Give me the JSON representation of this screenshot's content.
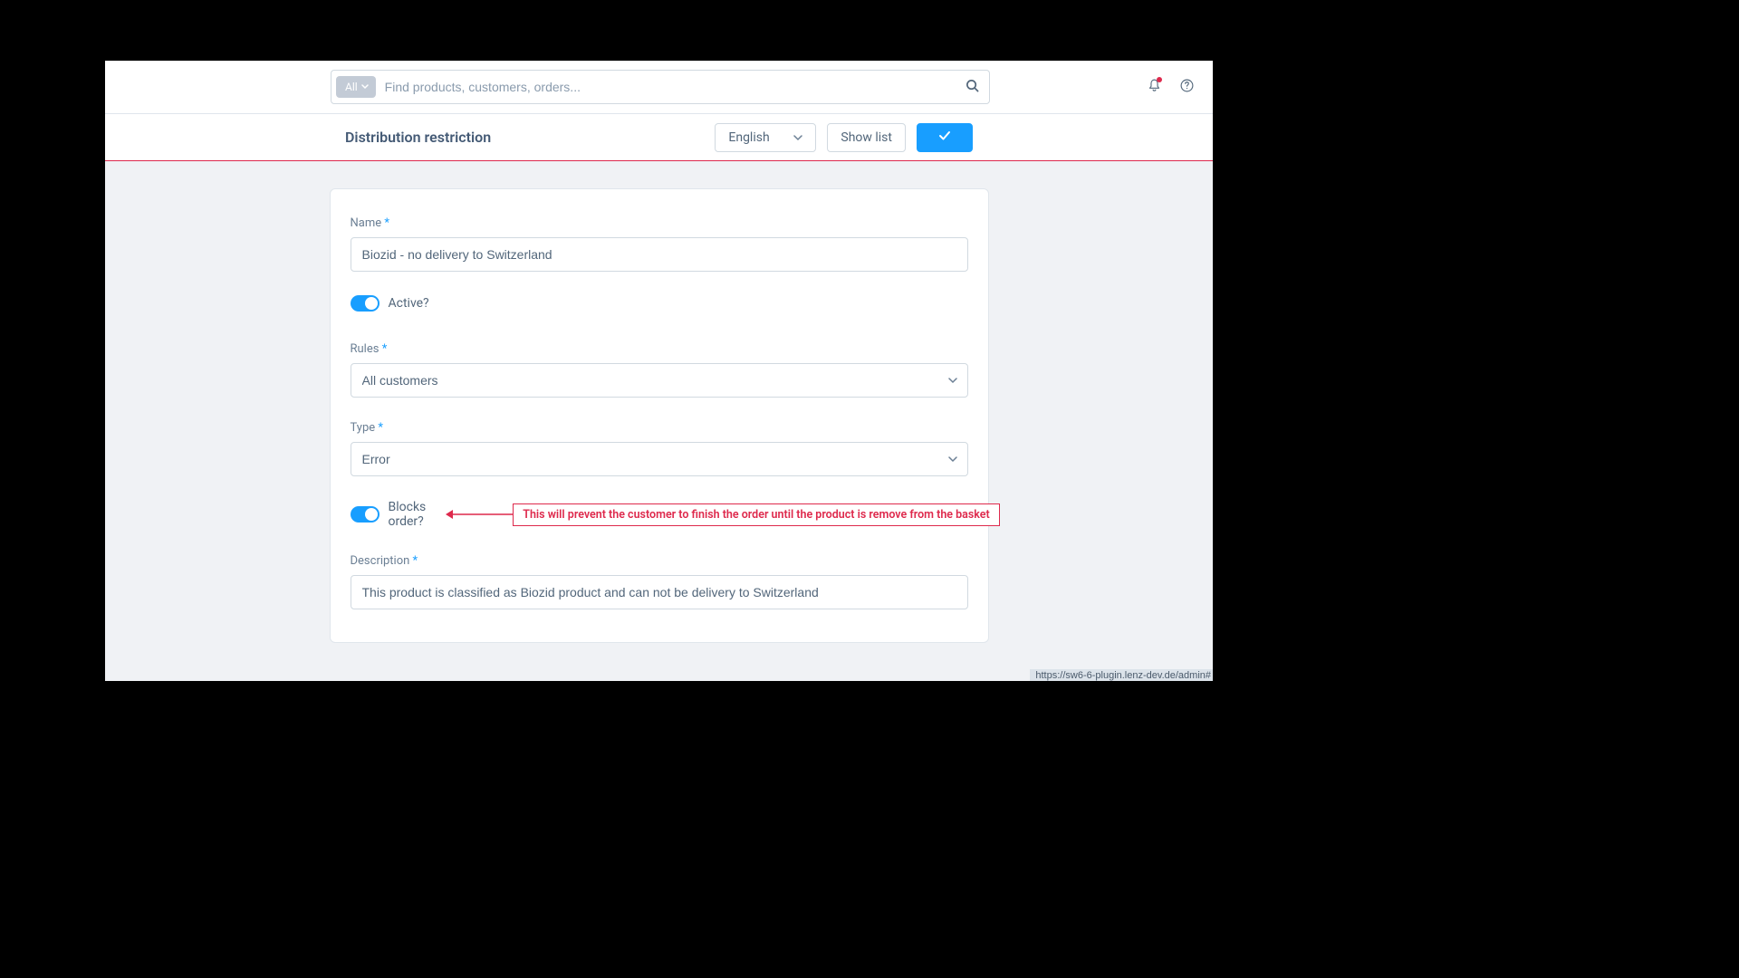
{
  "search": {
    "filter_label": "All",
    "placeholder": "Find products, customers, orders..."
  },
  "subheader": {
    "title": "Distribution restriction",
    "language": "English",
    "show_list_label": "Show list"
  },
  "form": {
    "name_label": "Name",
    "name_value": "Biozid - no delivery to Switzerland",
    "active_label": "Active?",
    "rules_label": "Rules",
    "rules_value": "All customers",
    "type_label": "Type",
    "type_value": "Error",
    "blocks_order_label": "Blocks order?",
    "description_label": "Description",
    "description_value": "This product is classified as Biozid product and can not be delivery to Switzerland"
  },
  "annotation": {
    "text": "This will prevent the customer to finish the order until the product is remove from the basket"
  },
  "status_url": "https://sw6-6-plugin.lenz-dev.de/admin#"
}
